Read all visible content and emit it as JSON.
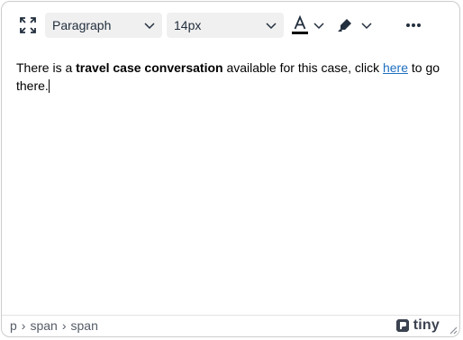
{
  "toolbar": {
    "block_format": "Paragraph",
    "font_size": "14px",
    "icons": [
      "fullscreen-icon",
      "text-color-icon",
      "highlight-icon",
      "more-icon"
    ],
    "text_color": "#000000"
  },
  "content": {
    "text1": "There is a ",
    "bold": "travel case conversation",
    "text2": " available for this case, click ",
    "link": "here",
    "text3": " to go there."
  },
  "statusbar": {
    "path": [
      "p",
      "span",
      "span"
    ],
    "brand": "tiny"
  }
}
